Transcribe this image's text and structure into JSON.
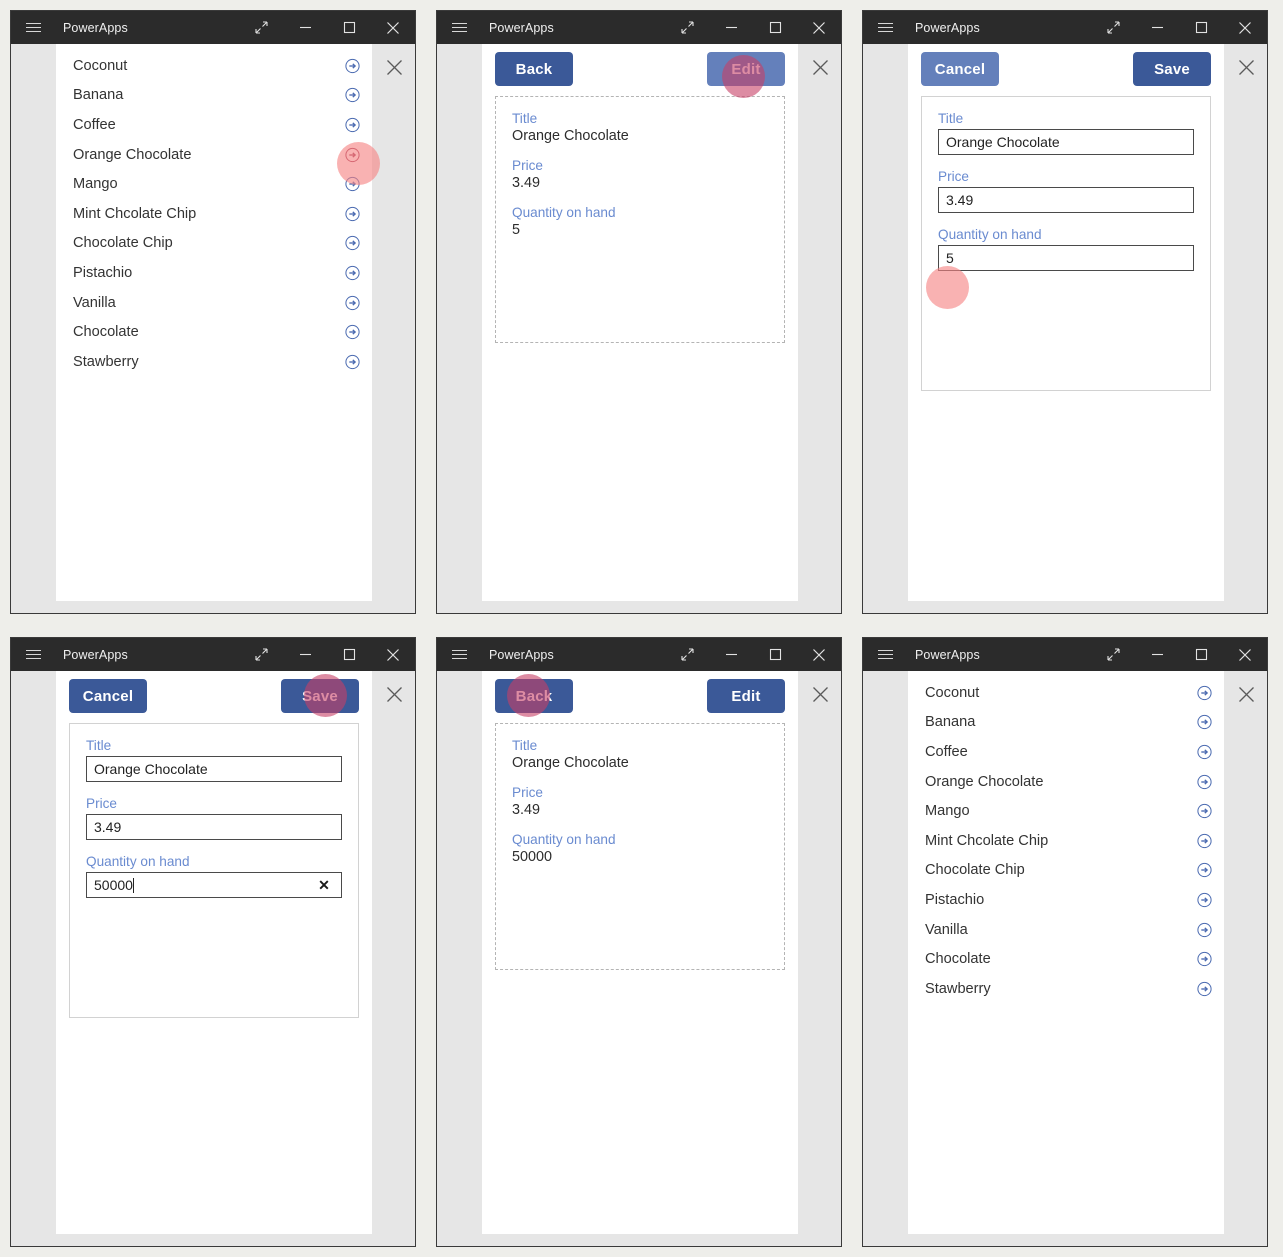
{
  "window": {
    "title": "PowerApps",
    "controls": [
      {
        "name": "restore-diagonal-icon",
        "glyph": "expand"
      },
      {
        "name": "minimize-icon",
        "glyph": "minimize"
      },
      {
        "name": "maximize-icon",
        "glyph": "maximize"
      },
      {
        "name": "close-icon",
        "glyph": "close"
      }
    ],
    "hamburger": "menu-icon"
  },
  "colors": {
    "titlebar_bg": "#2b2b2b",
    "app_chrome_bg": "#e6e6e6",
    "primary_button": "#3b5998",
    "dim_button": "#6480bb",
    "field_label": "#6a8bd0",
    "arrow_icon": "#4a6ab0",
    "halo_pink": "#f68282",
    "halo_rose": "#c73f65",
    "page_bg": "#eeeeea"
  },
  "list_screen": {
    "items": [
      "Coconut",
      "Banana",
      "Coffee",
      "Orange Chocolate",
      "Mango",
      "Mint Chcolate Chip",
      "Chocolate Chip",
      "Pistachio",
      "Vanilla",
      "Chocolate",
      "Stawberry"
    ],
    "row_arrow_icon": "arrow-right-circle-icon",
    "close_icon": "close-icon"
  },
  "detail_screen": {
    "back_label": "Back",
    "edit_label": "Edit",
    "fields": [
      {
        "label": "Title",
        "value": "Orange Chocolate"
      },
      {
        "label": "Price",
        "value": "3.49"
      },
      {
        "label": "Quantity on hand",
        "value": "5"
      }
    ]
  },
  "detail_screen_updated": {
    "back_label": "Back",
    "edit_label": "Edit",
    "fields": [
      {
        "label": "Title",
        "value": "Orange Chocolate"
      },
      {
        "label": "Price",
        "value": "3.49"
      },
      {
        "label": "Quantity on hand",
        "value": "50000"
      }
    ]
  },
  "edit_screen": {
    "cancel_label": "Cancel",
    "save_label": "Save",
    "fields": [
      {
        "label": "Title",
        "value": "Orange Chocolate"
      },
      {
        "label": "Price",
        "value": "3.49"
      },
      {
        "label": "Quantity on hand",
        "value": "5"
      }
    ]
  },
  "edit_screen_typed": {
    "cancel_label": "Cancel",
    "save_label": "Save",
    "clear_icon": "clear-x-icon",
    "fields": [
      {
        "label": "Title",
        "value": "Orange Chocolate"
      },
      {
        "label": "Price",
        "value": "3.49"
      },
      {
        "label": "Quantity on hand",
        "value": "50000"
      }
    ]
  },
  "panels": [
    {
      "id": 1,
      "kind": "list",
      "highlight": "row-arrow-orange-chocolate"
    },
    {
      "id": 2,
      "kind": "detail",
      "highlight": "edit-button"
    },
    {
      "id": 3,
      "kind": "edit",
      "highlight": "quantity-input"
    },
    {
      "id": 4,
      "kind": "edit",
      "highlight": "save-button"
    },
    {
      "id": 5,
      "kind": "detail",
      "highlight": "back-button"
    },
    {
      "id": 6,
      "kind": "list",
      "highlight": "none"
    }
  ]
}
